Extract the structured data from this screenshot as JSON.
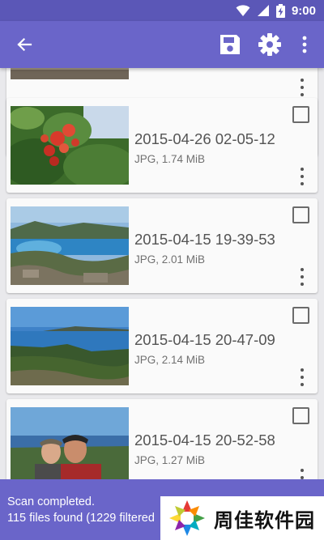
{
  "status_bar": {
    "time": "9:00",
    "icons": [
      "wifi-icon",
      "signal-icon",
      "battery-charging-icon"
    ]
  },
  "toolbar": {
    "back": "back-arrow-icon",
    "save": "save-icon",
    "settings": "gear-icon",
    "more": "more-vert-icon",
    "color": "#6a65c9"
  },
  "files": [
    {
      "date": "",
      "meta": "",
      "thumb": "thumbnail-partial"
    },
    {
      "date": "2015-04-26 02-05-12",
      "meta": "JPG, 1.74 MiB",
      "thumb": "thumbnail-red-flowers"
    },
    {
      "date": "2015-04-15 19-39-53",
      "meta": "JPG, 2.01 MiB",
      "thumb": "thumbnail-bay-landscape"
    },
    {
      "date": "2015-04-15 20-47-09",
      "meta": "JPG, 2.14 MiB",
      "thumb": "thumbnail-coast-view"
    },
    {
      "date": "2015-04-15 20-52-58",
      "meta": "JPG, 1.27 MiB",
      "thumb": "thumbnail-selfie"
    }
  ],
  "bottom": {
    "line1": "Scan completed.",
    "line2": "115 files found (1229 filtered"
  },
  "watermark": {
    "text": "周佳软件园"
  }
}
